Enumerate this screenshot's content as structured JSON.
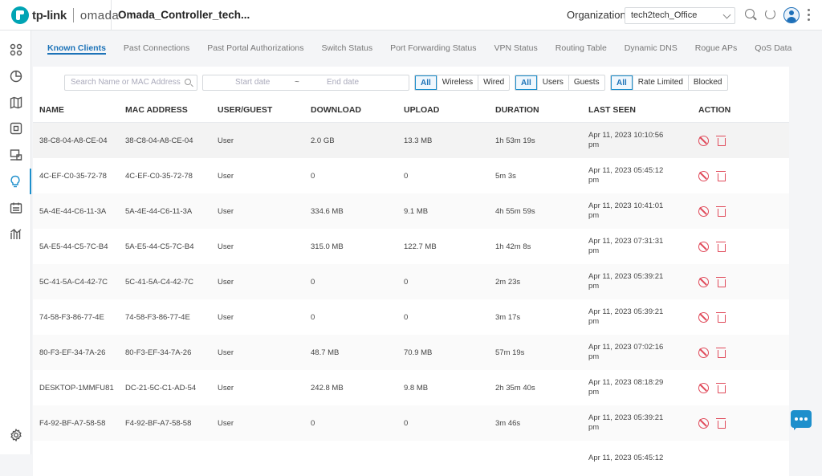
{
  "header": {
    "brand": "tp-link",
    "product": "omada",
    "controller_title": "Omada_Controller_tech...",
    "org_label": "Organization:",
    "org_value": "tech2tech_Office"
  },
  "sidebar": {
    "items": [
      "dashboard-icon",
      "statistics-icon",
      "map-icon",
      "devices-icon",
      "network-icon",
      "insights-icon",
      "logs-icon",
      "reports-icon",
      "settings-icon"
    ],
    "active": "insights-icon"
  },
  "tabs": [
    {
      "label": "Known Clients",
      "active": true
    },
    {
      "label": "Past Connections"
    },
    {
      "label": "Past Portal Authorizations"
    },
    {
      "label": "Switch Status"
    },
    {
      "label": "Port Forwarding Status"
    },
    {
      "label": "VPN Status"
    },
    {
      "label": "Routing Table"
    },
    {
      "label": "Dynamic DNS"
    },
    {
      "label": "Rogue APs"
    },
    {
      "label": "QoS Data"
    }
  ],
  "filters": {
    "search_placeholder": "Search Name or MAC Address",
    "start_date": "Start date",
    "date_sep": "~",
    "end_date": "End date",
    "conn": [
      "All",
      "Wireless",
      "Wired"
    ],
    "user": [
      "All",
      "Users",
      "Guests"
    ],
    "limit": [
      "All",
      "Rate Limited",
      "Blocked"
    ]
  },
  "table": {
    "columns": [
      "NAME",
      "MAC ADDRESS",
      "USER/GUEST",
      "DOWNLOAD",
      "UPLOAD",
      "DURATION",
      "LAST SEEN",
      "ACTION"
    ],
    "rows": [
      {
        "name": "38-C8-04-A8-CE-04",
        "mac": "38-C8-04-A8-CE-04",
        "type": "User",
        "down": "2.0 GB",
        "up": "13.3 MB",
        "dur": "1h 53m 19s",
        "seen1": "Apr 11, 2023 10:10:56",
        "seen2": "pm"
      },
      {
        "name": "4C-EF-C0-35-72-78",
        "mac": "4C-EF-C0-35-72-78",
        "type": "User",
        "down": "0",
        "up": "0",
        "dur": "5m 3s",
        "seen1": "Apr 11, 2023 05:45:12",
        "seen2": "pm"
      },
      {
        "name": "5A-4E-44-C6-11-3A",
        "mac": "5A-4E-44-C6-11-3A",
        "type": "User",
        "down": "334.6 MB",
        "up": "9.1 MB",
        "dur": "4h 55m 59s",
        "seen1": "Apr 11, 2023 10:41:01",
        "seen2": "pm"
      },
      {
        "name": "5A-E5-44-C5-7C-B4",
        "mac": "5A-E5-44-C5-7C-B4",
        "type": "User",
        "down": "315.0 MB",
        "up": "122.7 MB",
        "dur": "1h 42m 8s",
        "seen1": "Apr 11, 2023 07:31:31",
        "seen2": "pm"
      },
      {
        "name": "5C-41-5A-C4-42-7C",
        "mac": "5C-41-5A-C4-42-7C",
        "type": "User",
        "down": "0",
        "up": "0",
        "dur": "2m 23s",
        "seen1": "Apr 11, 2023 05:39:21",
        "seen2": "pm"
      },
      {
        "name": "74-58-F3-86-77-4E",
        "mac": "74-58-F3-86-77-4E",
        "type": "User",
        "down": "0",
        "up": "0",
        "dur": "3m 17s",
        "seen1": "Apr 11, 2023 05:39:21",
        "seen2": "pm"
      },
      {
        "name": "80-F3-EF-34-7A-26",
        "mac": "80-F3-EF-34-7A-26",
        "type": "User",
        "down": "48.7 MB",
        "up": "70.9 MB",
        "dur": "57m 19s",
        "seen1": "Apr 11, 2023 07:02:16",
        "seen2": "pm"
      },
      {
        "name": "DESKTOP-1MMFU81",
        "mac": "DC-21-5C-C1-AD-54",
        "type": "User",
        "down": "242.8 MB",
        "up": "9.8 MB",
        "dur": "2h 35m 40s",
        "seen1": "Apr 11, 2023 08:18:29",
        "seen2": "pm"
      },
      {
        "name": "F4-92-BF-A7-58-58",
        "mac": "F4-92-BF-A7-58-58",
        "type": "User",
        "down": "0",
        "up": "0",
        "dur": "3m 46s",
        "seen1": "Apr 11, 2023 05:39:21",
        "seen2": "pm"
      },
      {
        "name": "",
        "mac": "",
        "type": "",
        "down": "",
        "up": "",
        "dur": "",
        "seen1": "Apr 11, 2023 05:45:12",
        "seen2": ""
      }
    ]
  }
}
